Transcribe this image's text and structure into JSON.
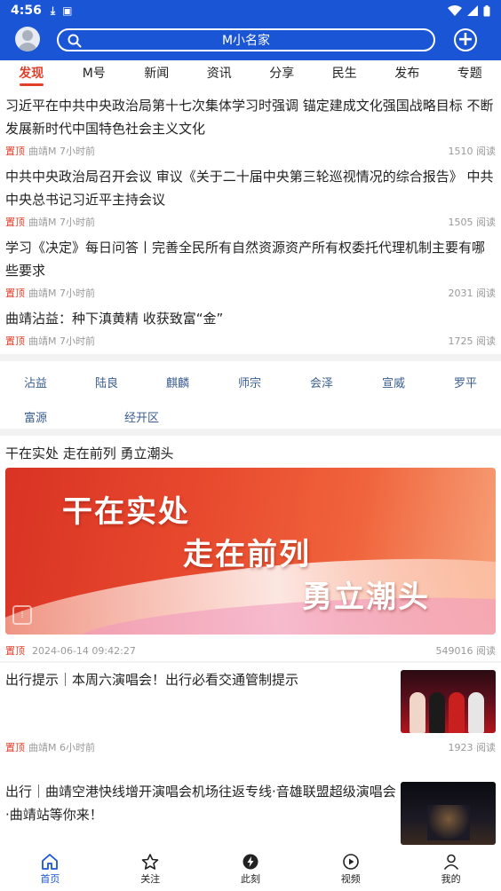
{
  "status_bar": {
    "time": "4:56"
  },
  "header": {
    "search_text": "M小名家"
  },
  "tabs": [
    "发现",
    "M号",
    "新闻",
    "资讯",
    "分享",
    "民生",
    "发布",
    "专题"
  ],
  "news": [
    {
      "title": "习近平在中共中央政治局第十七次集体学习时强调 锚定建成文化强国战略目标 不断发展新时代中国特色社会主义文化",
      "pin": "置顶",
      "source": "曲靖M",
      "time": "7小时前",
      "reads": "1510 阅读"
    },
    {
      "title": "中共中央政治局召开会议 审议《关于二十届中央第三轮巡视情况的综合报告》 中共中央总书记习近平主持会议",
      "pin": "置顶",
      "source": "曲靖M",
      "time": "7小时前",
      "reads": "1505 阅读"
    },
    {
      "title": "学习《决定》每日问答丨完善全民所有自然资源资产所有权委托代理机制主要有哪些要求",
      "pin": "置顶",
      "source": "曲靖M",
      "time": "7小时前",
      "reads": "2031 阅读"
    },
    {
      "title": "曲靖沾益：种下滇黄精 收获致富“金”",
      "pin": "置顶",
      "source": "曲靖M",
      "time": "7小时前",
      "reads": "1725 阅读"
    }
  ],
  "regions": [
    "沾益",
    "陆良",
    "麒麟",
    "师宗",
    "会泽",
    "宣威",
    "罗平",
    "富源",
    "经开区"
  ],
  "feature": {
    "title": "干在实处 走在前列 勇立潮头",
    "banner_lines": [
      "干在实处",
      "走在前列",
      "勇立潮头"
    ],
    "pin": "置顶",
    "datetime": "2024-06-14 09:42:27",
    "reads": "549016 阅读"
  },
  "thumb_news": [
    {
      "title": "出行提示｜本周六演唱会！出行必看交通管制提示",
      "pin": "置顶",
      "source": "曲靖M",
      "time": "6小时前",
      "reads": "1923 阅读"
    },
    {
      "title": "出行｜曲靖空港快线增开演唱会机场往返专线·音雄联盟超级演唱会·曲靖站等你来！"
    }
  ],
  "bottom_nav": [
    "首页",
    "关注",
    "此刻",
    "视频",
    "我的"
  ],
  "colors": {
    "brand_blue": "#1a55d6",
    "accent_red": "#e0402a",
    "region_text": "#3a5c8e"
  }
}
